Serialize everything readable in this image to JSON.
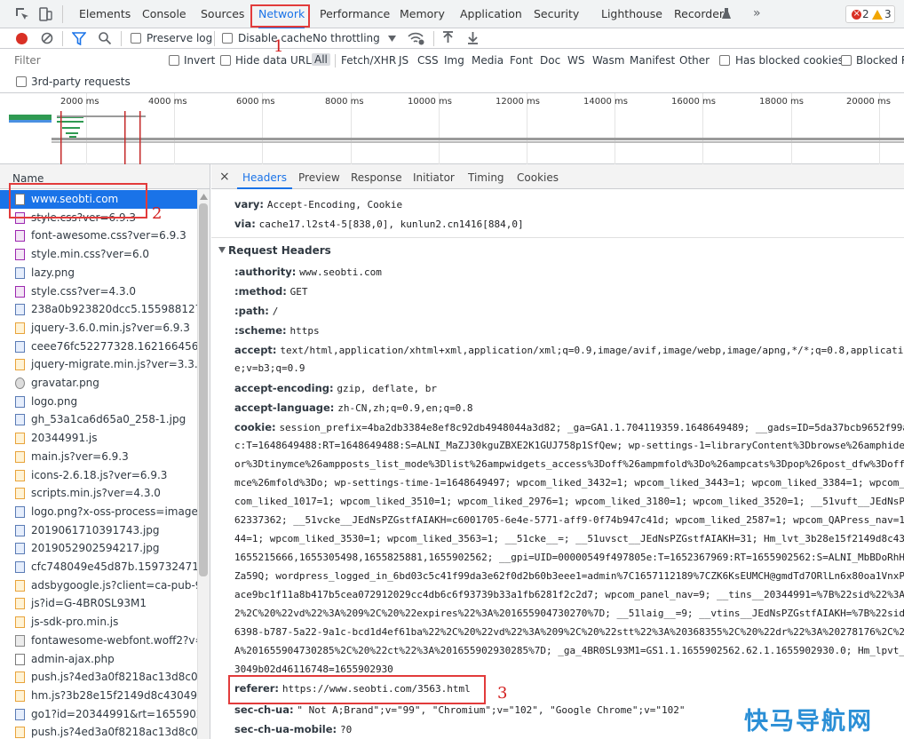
{
  "tabs": [
    "Elements",
    "Console",
    "Sources",
    "Network",
    "Performance",
    "Memory",
    "Application",
    "Security",
    "Lighthouse",
    "Recorder"
  ],
  "active_tab": "Network",
  "more_tabs_glyph": "»",
  "issues": {
    "errors": "2",
    "warnings": "3"
  },
  "toolbar": {
    "preserve_log": "Preserve log",
    "disable_cache": "Disable cache",
    "throttling": "No throttling"
  },
  "filter": {
    "placeholder": "Filter",
    "invert": "Invert",
    "hide_data_urls": "Hide data URLs",
    "types": [
      "All",
      "Fetch/XHR",
      "JS",
      "CSS",
      "Img",
      "Media",
      "Font",
      "Doc",
      "WS",
      "Wasm",
      "Manifest",
      "Other"
    ],
    "has_blocked_cookies": "Has blocked cookies",
    "blocked_requests": "Blocked Re",
    "third_party": "3rd-party requests"
  },
  "overview": {
    "ticks": [
      "2000 ms",
      "4000 ms",
      "6000 ms",
      "8000 ms",
      "10000 ms",
      "12000 ms",
      "14000 ms",
      "16000 ms",
      "18000 ms",
      "20000 ms"
    ]
  },
  "requests": {
    "header": "Name",
    "items": [
      {
        "name": "www.seobti.com",
        "type": "doc"
      },
      {
        "name": "style.css?ver=6.9.3",
        "type": "css"
      },
      {
        "name": "font-awesome.css?ver=6.9.3",
        "type": "css"
      },
      {
        "name": "style.min.css?ver=6.0",
        "type": "css"
      },
      {
        "name": "lazy.png",
        "type": "img"
      },
      {
        "name": "style.css?ver=4.3.0",
        "type": "css"
      },
      {
        "name": "238a0b923820dcc5.1559881277.jpg",
        "type": "img"
      },
      {
        "name": "jquery-3.6.0.min.js?ver=6.9.3",
        "type": "js"
      },
      {
        "name": "ceee76fc52277328.1621664564.jpg",
        "type": "img"
      },
      {
        "name": "jquery-migrate.min.js?ver=3.3.2",
        "type": "js"
      },
      {
        "name": "gravatar.png",
        "type": "gear"
      },
      {
        "name": "logo.png",
        "type": "img"
      },
      {
        "name": "gh_53a1ca6d65a0_258-1.jpg",
        "type": "img"
      },
      {
        "name": "20344991.js",
        "type": "js"
      },
      {
        "name": "main.js?ver=6.9.3",
        "type": "js"
      },
      {
        "name": "icons-2.6.18.js?ver=6.9.3",
        "type": "js"
      },
      {
        "name": "scripts.min.js?ver=4.3.0",
        "type": "js"
      },
      {
        "name": "logo.png?x-oss-process=image%2I",
        "type": "img"
      },
      {
        "name": "2019061710391743.jpg",
        "type": "img"
      },
      {
        "name": "2019052902594217.jpg",
        "type": "img"
      },
      {
        "name": "cfc748049e45d87b.1597324710.jpg",
        "type": "img"
      },
      {
        "name": "adsbygoogle.js?client=ca-pub-951",
        "type": "js"
      },
      {
        "name": "js?id=G-4BR0SL93M1",
        "type": "js"
      },
      {
        "name": "js-sdk-pro.min.js",
        "type": "js"
      },
      {
        "name": "fontawesome-webfont.woff2?v=4.7",
        "type": "font"
      },
      {
        "name": "admin-ajax.php",
        "type": "doc"
      },
      {
        "name": "push.js?4ed3a0f8218ac13d8c07c3c",
        "type": "js"
      },
      {
        "name": "hm.js?3b28e15f2149d8c43049b02c",
        "type": "js"
      },
      {
        "name": "go1?id=20344991&rt=1655902937",
        "type": "img"
      },
      {
        "name": "push.js?4ed3a0f8218ac13d8c07c3c",
        "type": "js"
      }
    ]
  },
  "detail": {
    "close_glyph": "×",
    "tabs": [
      "Headers",
      "Preview",
      "Response",
      "Initiator",
      "Timing",
      "Cookies"
    ],
    "active_tab": "Headers",
    "response_headers_tail": [
      {
        "key": "vary:",
        "value": "Accept-Encoding, Cookie"
      },
      {
        "key": "via:",
        "value": "cache17.l2st4-5[838,0], kunlun2.cn1416[884,0]"
      }
    ],
    "request_headers_title": "Request Headers",
    "request_headers": [
      {
        "key": ":authority:",
        "value": "www.seobti.com"
      },
      {
        "key": ":method:",
        "value": "GET"
      },
      {
        "key": ":path:",
        "value": "/"
      },
      {
        "key": ":scheme:",
        "value": "https"
      },
      {
        "key": "accept:",
        "value": "text/html,application/xhtml+xml,application/xml;q=0.9,image/avif,image/webp,image/apng,*/*;q=0.8,application"
      },
      {
        "key": "",
        "value": "e;v=b3;q=0.9"
      },
      {
        "key": "accept-encoding:",
        "value": "gzip, deflate, br"
      },
      {
        "key": "accept-language:",
        "value": "zh-CN,zh;q=0.9,en;q=0.8"
      },
      {
        "key": "cookie:",
        "value": "session_prefix=4ba2db3384e8ef8c92db4948044a3d82; _ga=GA1.1.704119359.1648649489; __gads=ID=5da37bcb9652f99a"
      }
    ],
    "cookie_lines": [
      "c:T=1648649488:RT=1648649488:S=ALNI_MaZJ30kguZBXE2K1GUJ758p1SfQew; wp-settings-1=libraryContent%3Dbrowse%26amphide",
      "or%3Dtinymce%26ampposts_list_mode%3Dlist%26ampwidgets_access%3Doff%26ampmfold%3Do%26ampcats%3Dpop%26post_dfw%3Doff",
      "mce%26mfold%3Do; wp-settings-time-1=1648649497; wpcom_liked_3432=1; wpcom_liked_3443=1; wpcom_liked_3384=1; wpcom_",
      "com_liked_1017=1; wpcom_liked_3510=1; wpcom_liked_2976=1; wpcom_liked_3180=1; wpcom_liked_3520=1; __51vuft__JEdNsP",
      "62337362; __51vcke__JEdNsPZGstfAIAKH=c6001705-6e4e-5771-aff9-0f74b947c41d; wpcom_liked_2587=1; wpcom_QAPress_nav=1",
      "44=1; wpcom_liked_3530=1; wpcom_liked_3563=1; __51cke__=; __51uvsct__JEdNsPZGstfAIAKH=31; Hm_lvt_3b28e15f2149d8c430",
      "1655215666,1655305498,1655825881,1655902562; __gpi=UID=00000549f497805e:T=1652367969:RT=1655902562:S=ALNI_MbBDoRhH",
      "Za59Q; wordpress_logged_in_6bd03c5c41f99da3e62f0d2b60b3eee1=admin%7C1657112189%7CZK6KsEUMCH@gmdTd7ORlLn6x80oa1VnxP",
      "ace9bc1f11a8b417b5cea072912029cc4db6c6f93739b33a1fb6281f2c2d7; wpcom_panel_nav=9; __tins__20344991=%7B%22sid%22%3A",
      "2%2C%20%22vd%22%3A%209%2C%20%22expires%22%3A%201655904730270%7D; __51laig__=9; __vtins__JEdNsPZGstfAIAKH=%7B%22sid",
      "6398-b787-5a22-9a1c-bcd1d4ef61ba%22%2C%20%22vd%22%3A%209%2C%20%22stt%22%3A%20368355%2C%20%22dr%22%3A%20278176%2C%2",
      "A%201655904730285%2C%20%22ct%22%3A%201655902930285%7D; _ga_4BR0SL93M1=GS1.1.1655902562.62.1.1655902930.0; Hm_lpvt_",
      "3049b02d46116748=1655902930"
    ],
    "referer": {
      "key": "referer:",
      "value": "https://www.seobti.com/3563.html"
    },
    "sec_ch_ua": {
      "key": "sec-ch-ua:",
      "value": "\" Not A;Brand\";v=\"99\", \"Chromium\";v=\"102\", \"Google Chrome\";v=\"102\""
    },
    "sec_ch_ua_mobile": {
      "key": "sec-ch-ua-mobile:",
      "value": "?0"
    }
  },
  "annotations": [
    "1",
    "2",
    "3"
  ],
  "watermark": "快马导航网"
}
